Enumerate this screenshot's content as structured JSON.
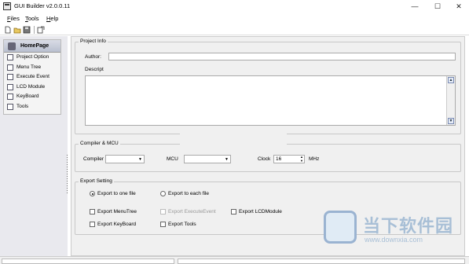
{
  "window": {
    "title": "GUI Builder v2.0.0.11",
    "minimize": "—",
    "maximize": "☐",
    "close": "✕"
  },
  "menu": [
    {
      "label": "Files"
    },
    {
      "label": "Tools"
    },
    {
      "label": "Help"
    }
  ],
  "sidebar": {
    "header": "HomePage",
    "items": [
      {
        "label": "Project Option"
      },
      {
        "label": "Menu Tree"
      },
      {
        "label": "Execute Event"
      },
      {
        "label": "LCD Module"
      },
      {
        "label": "KeyBoard"
      },
      {
        "label": "Tools"
      }
    ]
  },
  "project_info": {
    "title": "Project Info",
    "author_label": "Author:",
    "author_value": "",
    "descript_label": "Descript",
    "descript_value": ""
  },
  "compiler_mcu": {
    "title": "Compiler & MCU",
    "compiler_label": "Compiler",
    "compiler_value": "",
    "mcu_label": "MCU",
    "mcu_value": "",
    "clock_label": "Clock",
    "clock_value": "16",
    "clock_unit": "MHz"
  },
  "export_setting": {
    "title": "Export Setting",
    "radio_one_file": "Export to one file",
    "radio_each_file": "Export to each file",
    "selected_radio": "one",
    "cb_menutree": "Export MenuTree",
    "cb_executeevent": "Export ExecuteEvent",
    "cb_lcdmodule": "Export LCDModule",
    "cb_keyboard": "Export KeyBoard",
    "cb_tools": "Export Tools"
  },
  "watermark": {
    "text": "当下软件园",
    "url": "www.downxia.com"
  }
}
